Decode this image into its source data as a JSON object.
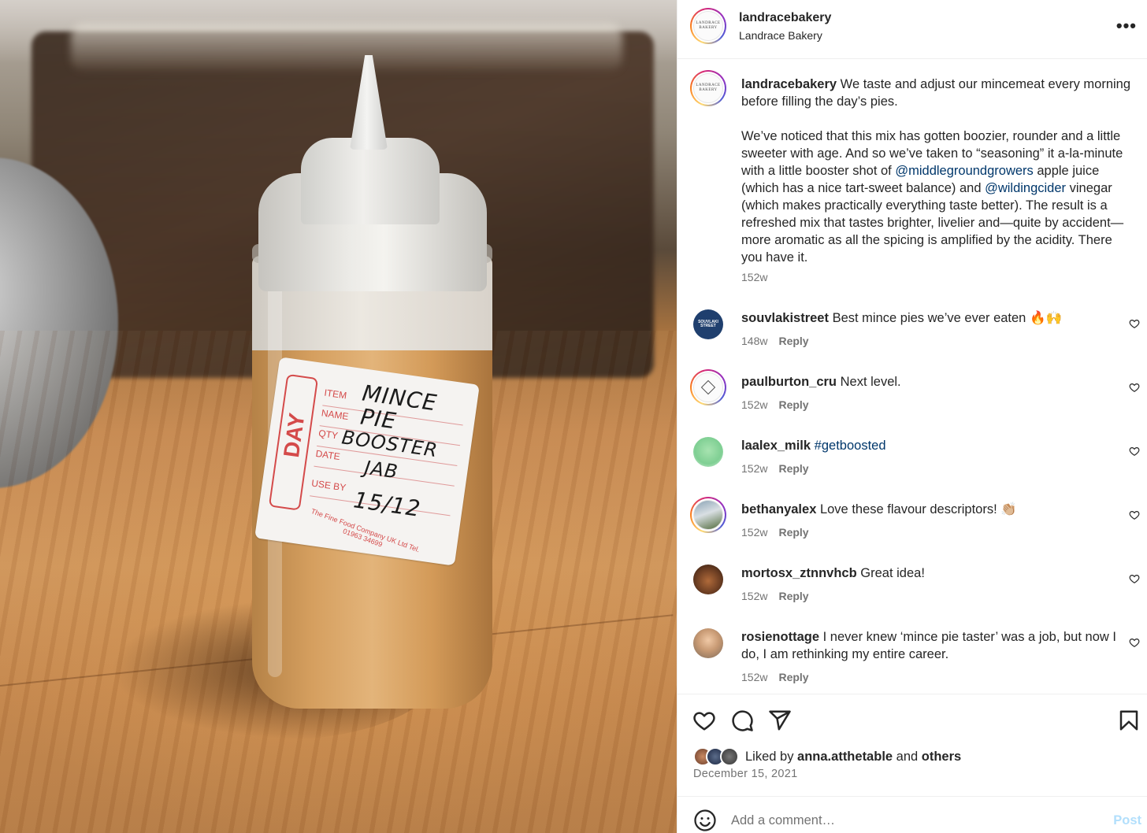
{
  "photo": {
    "alt": "Squeeze bottle labelled Mince Pie Booster",
    "label": {
      "day": "DAY",
      "fields": [
        "ITEM",
        "NAME",
        "QTY",
        "DATE",
        "USE BY"
      ],
      "handwriting": [
        "MINCE",
        "PIE",
        "BOOSTER",
        "JAB",
        "15/12"
      ],
      "fine_print": "The Fine Food Company UK Ltd Tel. 01963 34699"
    }
  },
  "header": {
    "username": "landracebakery",
    "subtitle": "Landrace Bakery",
    "more_icon": "more-horizontal-icon",
    "avatar_logo": "LANDRACE BAKERY"
  },
  "caption": {
    "username": "landracebakery",
    "text_1": " We taste and adjust our mincemeat every morning before filling the day’s pies.\n\nWe’ve noticed that this mix has gotten boozier, rounder and a little sweeter with age. And so we’ve taken to “seasoning” it a-la-minute with a little booster shot of ",
    "mention_1": "@middlegroundgrowers",
    "text_2": " apple juice (which has a nice tart-sweet balance) and ",
    "mention_2": "@wildingcider",
    "text_3": " vinegar (which makes practically everything taste better). The result is a refreshed mix that tastes brighter, livelier and—quite by accident—more aromatic as all the spicing is amplified by the acidity. There you have it.",
    "time": "152w"
  },
  "comments": [
    {
      "username": "souvlakistreet",
      "text": " Best mince pies we’ve ever eaten 🔥🙌",
      "time": "148w",
      "reply": "Reply",
      "avatar_text": "SOUVLAKI STREET"
    },
    {
      "username": "paulburton_cru",
      "text": " Next level.",
      "time": "152w",
      "reply": "Reply"
    },
    {
      "username": "laalex_milk",
      "text": " ",
      "hashtag": "#getboosted",
      "time": "152w",
      "reply": "Reply"
    },
    {
      "username": "bethanyalex",
      "text": " Love these flavour descriptors! 👏🏼",
      "time": "152w",
      "reply": "Reply"
    },
    {
      "username": "mortosx_ztnnvhcb",
      "text": " Great idea!",
      "time": "152w",
      "reply": "Reply"
    },
    {
      "username": "rosienottage",
      "text": " I never knew ‘mince pie taster’ was a job, but now I do, I am rethinking my entire career.",
      "time": "152w",
      "reply": "Reply"
    }
  ],
  "actions": {
    "icons": [
      "heart-icon",
      "comment-icon",
      "share-icon",
      "bookmark-icon"
    ],
    "liked_by_prefix": "Liked by ",
    "liked_by_user": "anna.atthetable",
    "liked_by_and": " and ",
    "liked_by_others": "others",
    "date": "December 15, 2021"
  },
  "add_comment": {
    "placeholder": "Add a comment…",
    "post_label": "Post"
  },
  "colors": {
    "link": "#00376b",
    "muted": "#737373",
    "post_disabled": "#b2dffc",
    "text": "#262626"
  }
}
